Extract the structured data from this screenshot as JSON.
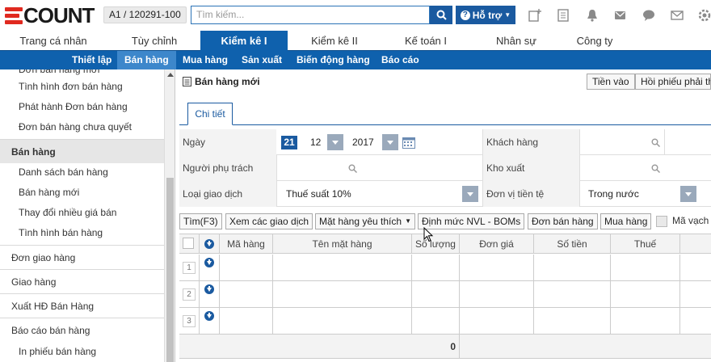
{
  "header": {
    "logo_text": "COUNT",
    "company": "A1 / 120291-100",
    "search_placeholder": "Tìm kiếm...",
    "help_label": "Hỗ trợ",
    "brand_red": "#e0291f",
    "accent": "#0f61ad"
  },
  "main_menu": [
    "Trang cá nhân",
    "Tùy chỉnh",
    "Kiểm kê I",
    "Kiểm kê II",
    "Kế toán I",
    "Nhân sự",
    "Công ty"
  ],
  "sub_menu": [
    "Thiết lập",
    "Bán hàng",
    "Mua hàng",
    "Sản xuất",
    "Biến động hàng",
    "Báo cáo"
  ],
  "sidebar": {
    "partial_top": "Đơn bán hàng mới",
    "sub_items_top": [
      "Tình hình đơn bán hàng",
      "Phát hành Đơn bán hàng",
      "Đơn bán hàng chưa quyết"
    ],
    "section_selected": "Bán hàng",
    "sub_items_sales": [
      "Danh sách bán hàng",
      "Bán hàng mới",
      "Thay đổi nhiều giá bán",
      "Tình hình bán hàng"
    ],
    "sections": [
      "Đơn giao hàng",
      "Giao hàng",
      "Xuất HĐ Bán Hàng",
      "Báo cáo bán hàng"
    ],
    "bottom_sub": "In phiếu bán hàng"
  },
  "content": {
    "title": "Bán hàng mới",
    "btn_currency": "Tiền vào",
    "btn_payment": "Hồi phiếu phải thu",
    "tab_detail": "Chi tiết",
    "form": {
      "date_label": "Ngày",
      "day": "21",
      "month": "12",
      "year": "2017",
      "customer_label": "Khách hàng",
      "person_label": "Người phụ trách",
      "warehouse_label": "Kho xuất",
      "trans_label": "Loại giao dịch",
      "trans_value": "Thuế suất 10%",
      "currency_label": "Đơn vị tiền tệ",
      "currency_value": "Trong nước"
    },
    "toolbar": [
      "Tìm(F3)",
      "Xem các giao dịch",
      "Mặt hàng yêu thích",
      "Định mức NVL - BOMs",
      "Đơn bán hàng",
      "Mua hàng"
    ],
    "barcode_label": "Mã vạch",
    "grid": {
      "columns": [
        "Mã hàng",
        "Tên mặt hàng",
        "Số lượng",
        "Đơn giá",
        "Số tiền",
        "Thuế"
      ],
      "rows": [
        "1",
        "2",
        "3"
      ],
      "total_qty": "0"
    }
  }
}
